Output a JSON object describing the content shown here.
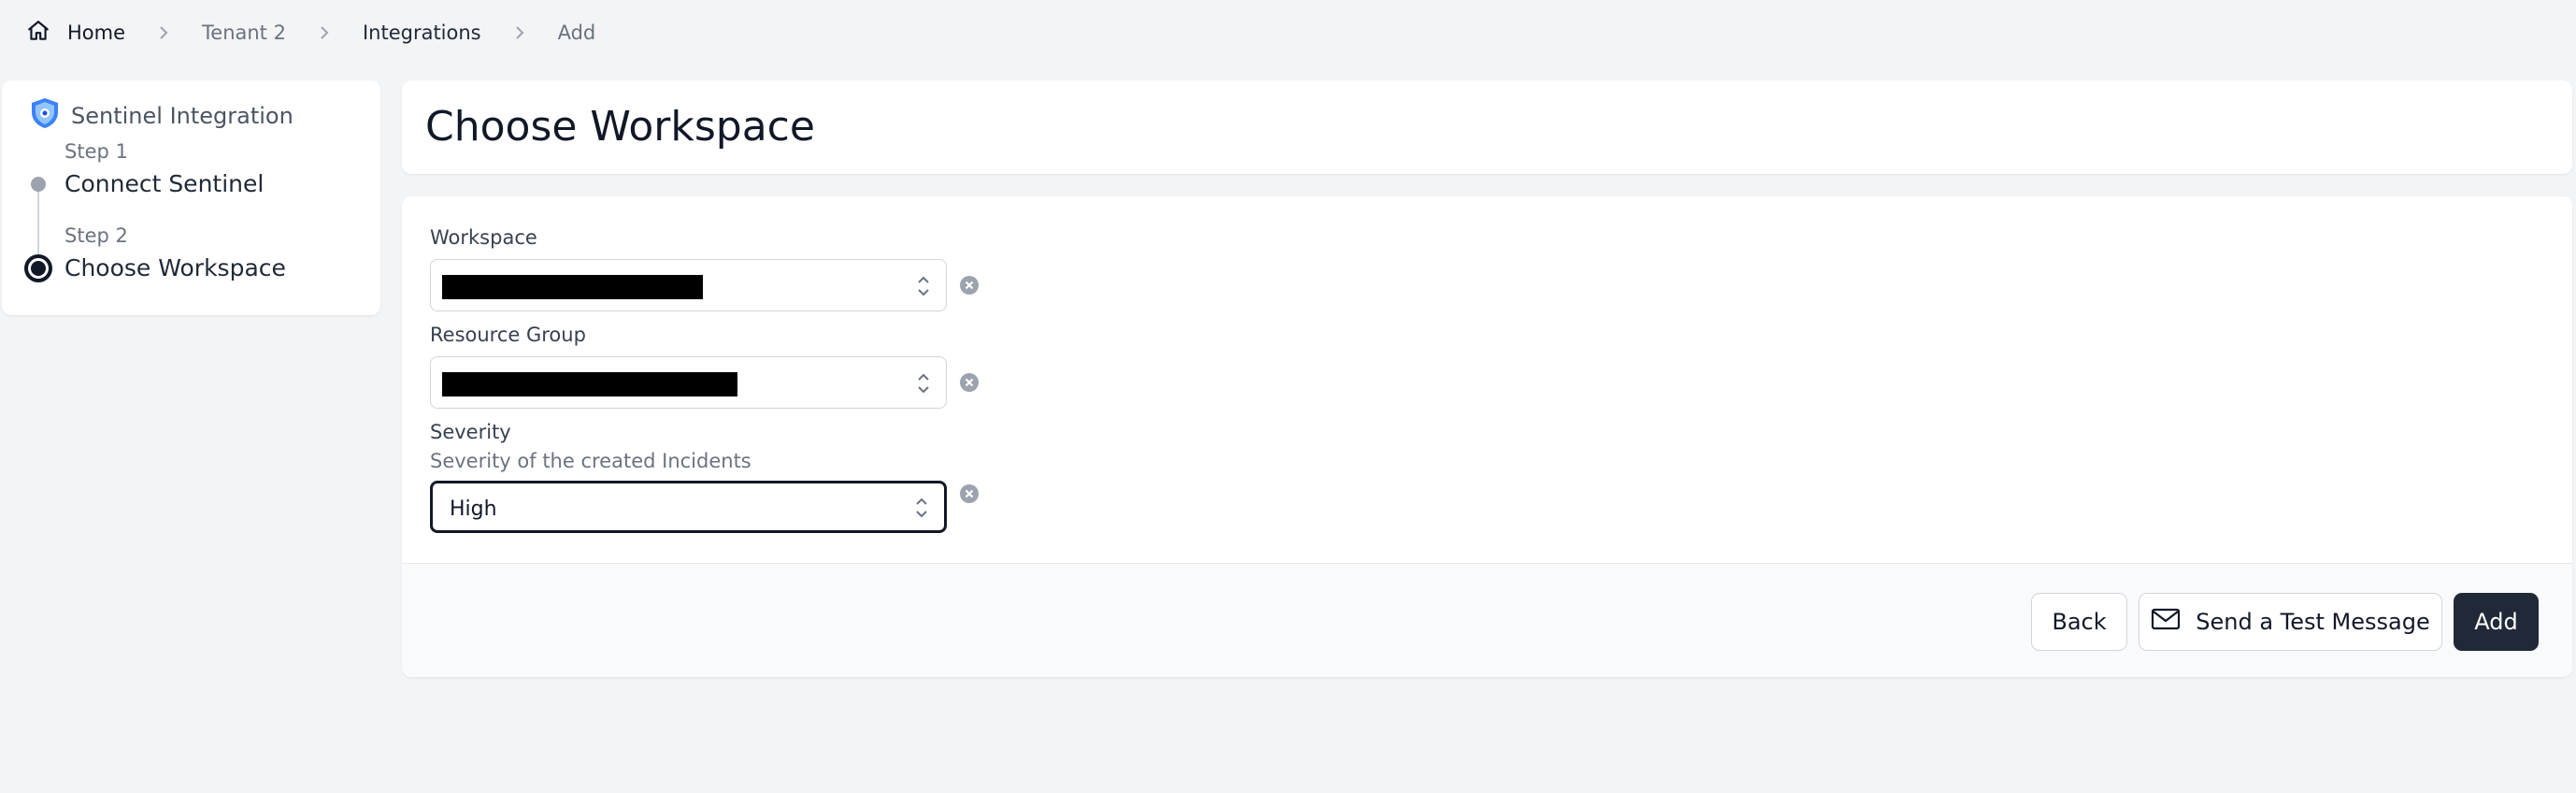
{
  "breadcrumb": {
    "home": "Home",
    "items": [
      "Tenant 2",
      "Integrations",
      "Add"
    ]
  },
  "sidebar": {
    "title": "Sentinel Integration",
    "steps": [
      {
        "label": "Step 1",
        "name": "Connect Sentinel"
      },
      {
        "label": "Step 2",
        "name": "Choose Workspace"
      }
    ]
  },
  "header": {
    "title": "Choose Workspace"
  },
  "form": {
    "workspace": {
      "label": "Workspace"
    },
    "resource_group": {
      "label": "Resource Group"
    },
    "severity": {
      "label": "Severity",
      "help": "Severity of the created Incidents",
      "value": "High"
    }
  },
  "footer": {
    "back_label": "Back",
    "test_label": "Send a Test Message",
    "add_label": "Add"
  },
  "colors": {
    "primary": "#1f2937",
    "background": "#f3f4f6",
    "accent_icon": "#3b82f6"
  }
}
